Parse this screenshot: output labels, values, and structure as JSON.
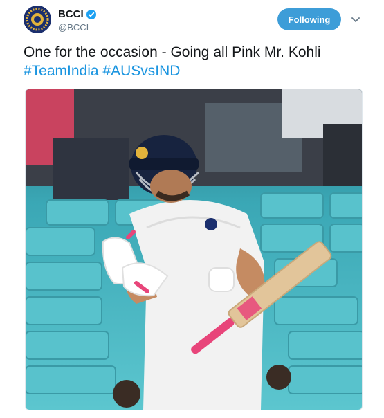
{
  "account": {
    "name": "BCCI",
    "handle": "@BCCI",
    "verified": true,
    "logo_colors": {
      "navy": "#1b2f6e",
      "gold": "#e2b33b"
    }
  },
  "header": {
    "follow_label": "Following",
    "menu_icon": "chevron-down-icon"
  },
  "tweet": {
    "text": "One for the occasion - Going all Pink Mr. Kohli",
    "hashtags": [
      "#TeamIndia",
      "#AUSvsIND"
    ]
  },
  "colors": {
    "follow_button": "#3d9dd8",
    "hashtag": "#1b95e0",
    "bat_grip": "#e8457a",
    "seats": "#4fb7c2"
  }
}
